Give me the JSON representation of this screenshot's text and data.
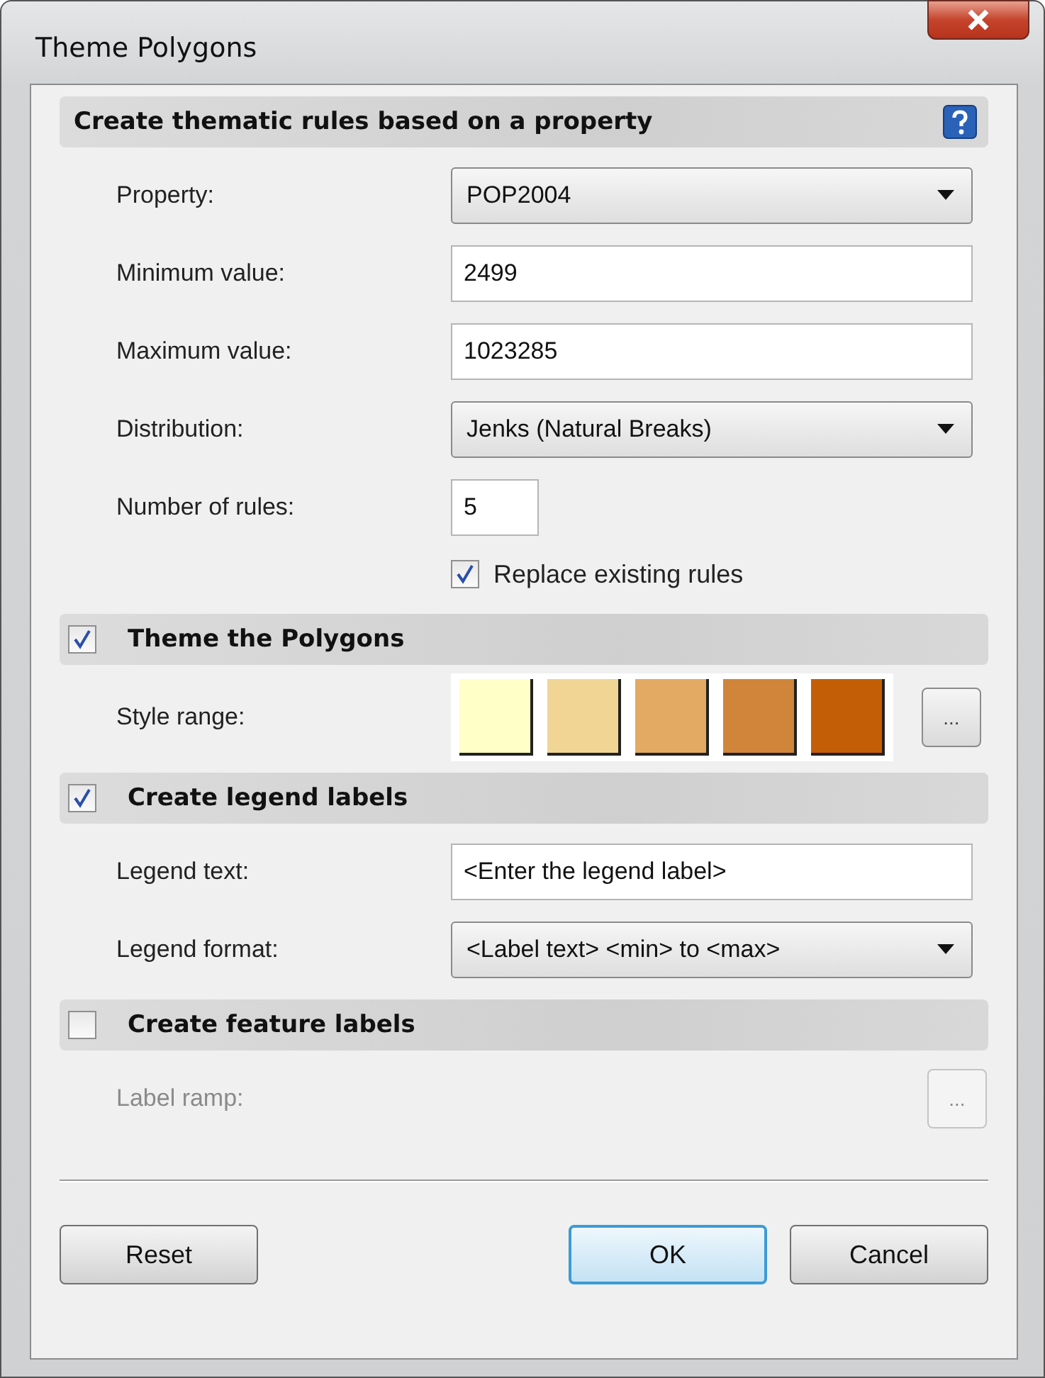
{
  "window": {
    "title": "Theme Polygons"
  },
  "sections": [
    {
      "title": "Create thematic rules based on a property",
      "kind": "plain",
      "help": true,
      "rows": [
        {
          "kind": "dropdown",
          "label": "Property:",
          "value": "POP2004",
          "disabled": false
        },
        {
          "kind": "text",
          "label": "Minimum value:",
          "value": "2499",
          "disabled": false
        },
        {
          "kind": "text",
          "label": "Maximum value:",
          "value": "1023285",
          "disabled": false
        },
        {
          "kind": "dropdown",
          "label": "Distribution:",
          "value": "Jenks (Natural Breaks)",
          "disabled": false
        },
        {
          "kind": "number",
          "label": "Number of rules:",
          "value": "5",
          "disabled": false
        },
        {
          "kind": "checkbox",
          "label": "Replace existing rules",
          "checked": true,
          "disabled": false
        }
      ]
    },
    {
      "title": "Theme the Polygons",
      "kind": "checkbox",
      "checked": true,
      "help": false,
      "rows": [
        {
          "kind": "swatches",
          "label": "Style range:",
          "swatches": [
            {
              "color": "#ffffc8"
            },
            {
              "color": "#f0d595"
            },
            {
              "color": "#e2aa62"
            },
            {
              "color": "#d0853a"
            },
            {
              "color": "#c45e06"
            }
          ],
          "button": "...",
          "disabled": false
        }
      ]
    },
    {
      "title": "Create legend labels",
      "kind": "checkbox",
      "checked": true,
      "help": false,
      "rows": [
        {
          "kind": "text",
          "label": "Legend text:",
          "value": "<Enter the legend label>",
          "disabled": false
        },
        {
          "kind": "dropdown",
          "label": "Legend format:",
          "value": "<Label text> <min> to <max>",
          "disabled": false
        }
      ]
    },
    {
      "title": "Create feature labels",
      "kind": "checkbox",
      "checked": false,
      "help": false,
      "rows": [
        {
          "kind": "ellipsis",
          "label": "Label ramp:",
          "button": "...",
          "disabled": true
        }
      ]
    }
  ],
  "buttons": [
    {
      "label": "Reset",
      "default": false
    },
    {
      "label": "OK",
      "default": true
    },
    {
      "label": "Cancel",
      "default": false
    }
  ]
}
